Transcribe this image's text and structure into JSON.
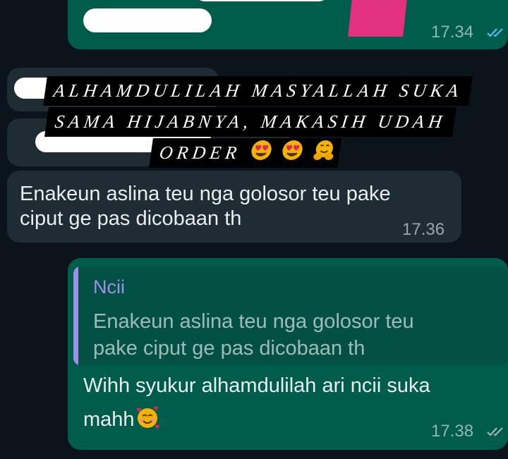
{
  "chat": {
    "messages": [
      {
        "id": "m1",
        "direction": "outgoing",
        "time": "17.34",
        "status": "read"
      },
      {
        "id": "m2",
        "direction": "incoming",
        "text_line1": "Enakeun aslina teu nga golosor teu pake",
        "text_line2": "ciput ge pas dicobaan th",
        "time": "17.36"
      },
      {
        "id": "m3",
        "direction": "outgoing",
        "reply": {
          "author": "Ncii",
          "text_line1": "Enakeun aslina teu nga golosor teu",
          "text_line2": "pake ciput ge pas dicobaan th"
        },
        "text_line1": "Wihh syukur alhamdulilah ari ncii suka",
        "text_line2": "mahh",
        "time": "17.38",
        "status": "read"
      }
    ]
  },
  "caption": {
    "line1": "ALHAMDULILAH MASYALLAH SUKA",
    "line2": "SAMA HIJABNYA, MAKASIH UDAH",
    "line3": "ORDER"
  },
  "icons": {
    "heart_eyes": "heart-eyes-emoji",
    "hugging": "hugging-face-emoji",
    "smiling_hearts": "smiling-face-with-hearts-emoji",
    "read_ticks": "double-check-icon"
  },
  "colors": {
    "background": "#0b141a",
    "outgoing_bubble": "#005c4b",
    "incoming_bubble": "#1f2c33",
    "reply_author": "#a08fe6",
    "tick_read": "#53bdeb"
  }
}
